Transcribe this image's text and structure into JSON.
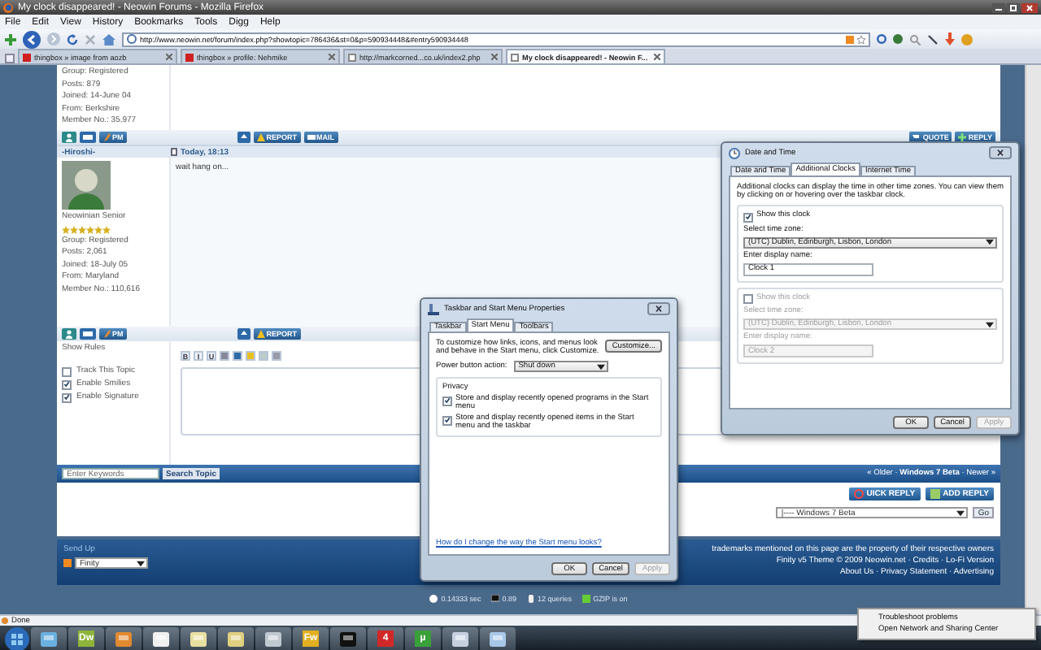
{
  "window": {
    "title": "My clock disappeared! - Neowin Forums - Mozilla Firefox"
  },
  "menu": [
    "File",
    "Edit",
    "View",
    "History",
    "Bookmarks",
    "Tools",
    "Digg",
    "Help"
  ],
  "address": {
    "value": "http://www.neowin.net/forum/index.php?showtopic=786436&st=0&p=590934448&#entry590934448"
  },
  "tabs": [
    {
      "label": "thingbox » image from aozb",
      "selected": false
    },
    {
      "label": "thingbox » profile: Nehmike",
      "selected": false
    },
    {
      "label": "http://markcorned...co.uk/index2.php",
      "selected": false
    },
    {
      "label": "My clock disappeared! - Neowin F...",
      "selected": true
    }
  ],
  "posts": [
    {
      "details": [
        "Group: Registered",
        "Posts: 879",
        "Joined: 14-June 04",
        "From: Berkshire",
        "Member No.: 35,977"
      ],
      "pm": "PM",
      "actions": [
        "REPORT",
        "MAIL"
      ],
      "reply_actions": [
        "QUOTE",
        "REPLY"
      ]
    },
    {
      "author": "-Hiroshi-",
      "time": "Today, 18:13",
      "body": "wait hang on...",
      "rank": "Neowinian Senior",
      "stars": 6,
      "details": [
        "Group: Registered",
        "Posts: 2,061",
        "Joined: 18-July 05",
        "From: Maryland",
        "Member No.: 110,616"
      ],
      "pm": "PM",
      "actions": [
        "REPORT"
      ]
    }
  ],
  "quick_reply": {
    "rules": "Show Rules",
    "options": [
      {
        "label": "Track This Topic",
        "checked": false
      },
      {
        "label": "Enable Smilies",
        "checked": true
      },
      {
        "label": "Enable Signature",
        "checked": true
      }
    ],
    "format_buttons": [
      "B",
      "I",
      "U"
    ]
  },
  "search": {
    "placeholder": "Enter Keywords",
    "button": "Search Topic"
  },
  "topic_nav": "« Older · **Windows 7 Beta** · Newer »",
  "reply_buttons": [
    "UICK REPLY",
    "ADD REPLY"
  ],
  "jump": {
    "value": "|---- Windows 7 Beta",
    "button": "Go"
  },
  "footer": {
    "skin_label": "Send Up",
    "skin": "Finity",
    "lines": [
      "trademarks mentioned on this page are the property of their respective owners",
      "Finity v5 Theme © 2009 Neowin.net · Credits · Lo-Fi Version",
      "About Us · Privacy Statement · Advertising"
    ]
  },
  "stats": [
    "0.14333 sec",
    "0.89",
    "12 queries",
    "GZIP is on"
  ],
  "status_bar": "Done",
  "taskbar": [
    {
      "kind": "icon"
    },
    {
      "kind": "badge",
      "label": "Dw",
      "color": "#8fb43a"
    },
    {
      "kind": "icon"
    },
    {
      "kind": "icon"
    },
    {
      "kind": "icon"
    },
    {
      "kind": "icon"
    },
    {
      "kind": "icon"
    },
    {
      "kind": "badge",
      "label": "Fw",
      "color": "#e0b020"
    },
    {
      "kind": "icon"
    },
    {
      "kind": "badge",
      "label": "4",
      "color": "#d02828"
    },
    {
      "kind": "badge",
      "label": "µ",
      "color": "#3aa03a"
    },
    {
      "kind": "icon"
    },
    {
      "kind": "icon"
    }
  ],
  "context_menu": [
    "Troubleshoot problems",
    "Open Network and Sharing Center"
  ],
  "taskbar_dialog": {
    "title": "Taskbar and Start Menu Properties",
    "tabs": [
      {
        "label": "Taskbar",
        "selected": false
      },
      {
        "label": "Start Menu",
        "selected": true
      },
      {
        "label": "Toolbars",
        "selected": false
      }
    ],
    "intro": "To customize how links, icons, and menus look and behave in the Start menu, click Customize.",
    "customize": "Customize...",
    "power_label": "Power button action:",
    "power": "Shut down",
    "privacy": "Privacy",
    "options": [
      {
        "label": "Store and display recently opened programs in the Start menu",
        "checked": true
      },
      {
        "label": "Store and display recently opened items in the Start menu and the taskbar",
        "checked": true
      }
    ],
    "help_link": "How do I change the way the Start menu looks?",
    "buttons": [
      {
        "label": "OK",
        "disabled": false
      },
      {
        "label": "Cancel",
        "disabled": false
      },
      {
        "label": "Apply",
        "disabled": true
      }
    ]
  },
  "clock_dialog": {
    "title": "Date and Time",
    "tabs": [
      {
        "label": "Date and Time",
        "selected": false
      },
      {
        "label": "Additional Clocks",
        "selected": true
      },
      {
        "label": "Internet Time",
        "selected": false
      }
    ],
    "intro": "Additional clocks can display the time in other time zones. You can view them by clicking on or hovering over the taskbar clock.",
    "clocks": [
      {
        "show": "Show this clock",
        "checked": true,
        "zone_label": "Select time zone:",
        "zone": "(UTC) Dublin, Edinburgh, Lisbon, London",
        "name_label": "Enter display name:",
        "name": "Clock 1"
      },
      {
        "show": "Show this clock",
        "checked": false,
        "zone_label": "Select time zone:",
        "zone": "(UTC) Dublin, Edinburgh, Lisbon, London",
        "name_label": "Enter display name:",
        "name": "Clock 2"
      }
    ],
    "buttons": [
      {
        "label": "OK",
        "disabled": false
      },
      {
        "label": "Cancel",
        "disabled": false
      },
      {
        "label": "Apply",
        "disabled": true
      }
    ]
  }
}
